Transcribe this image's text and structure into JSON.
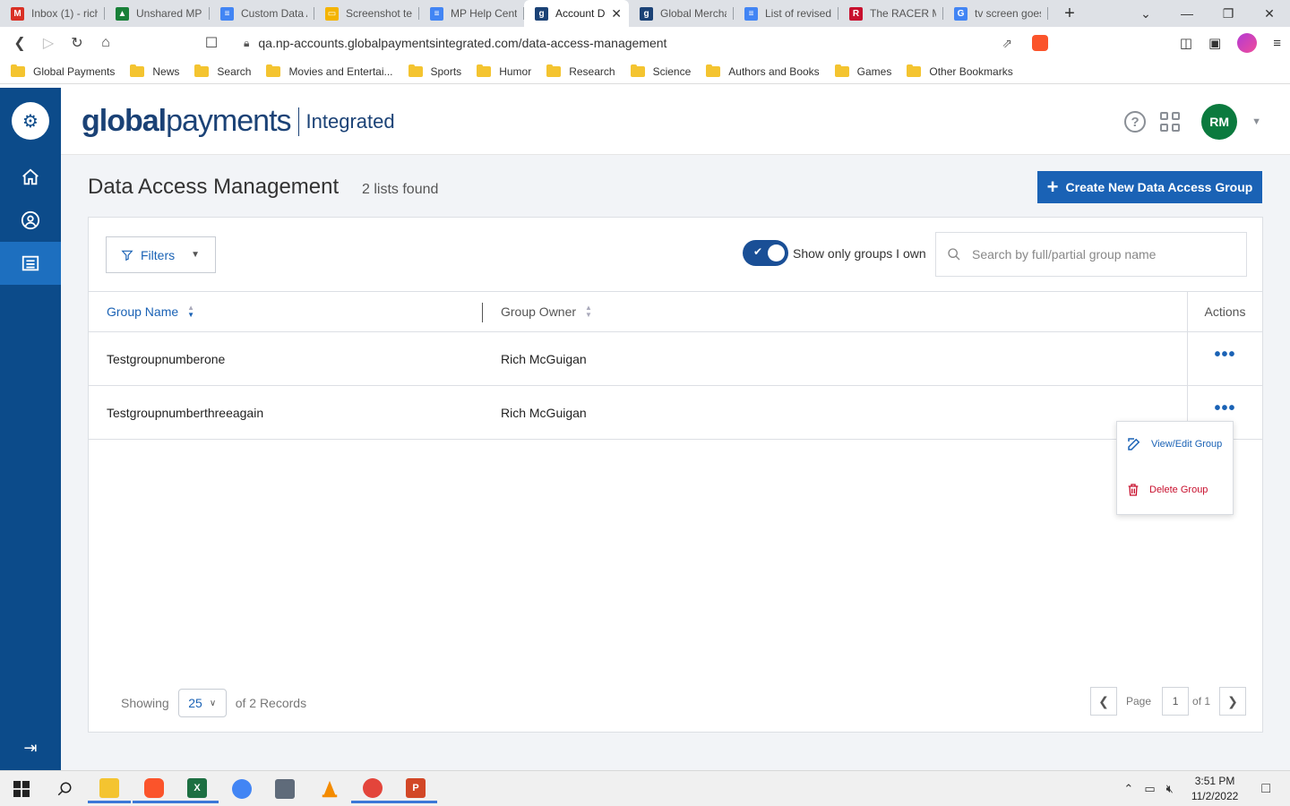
{
  "browser": {
    "tabs": [
      {
        "label": "Inbox (1) - rich",
        "icon": "gmail-icon",
        "color": "#d93025",
        "glyph": "M"
      },
      {
        "label": "Unshared MP H",
        "icon": "drive-icon",
        "color": "#188038",
        "glyph": "▲"
      },
      {
        "label": "Custom Data A",
        "icon": "docs-icon",
        "color": "#4285f4",
        "glyph": "≡"
      },
      {
        "label": "Screenshot tem",
        "icon": "slides-icon",
        "color": "#f4b400",
        "glyph": "▭"
      },
      {
        "label": "MP Help Cente",
        "icon": "docs-icon",
        "color": "#4285f4",
        "glyph": "≡"
      },
      {
        "label": "Account D",
        "icon": "globalpayments-icon",
        "color": "#1b4276",
        "glyph": "g",
        "active": true
      },
      {
        "label": "Global Mercha",
        "icon": "globalpayments-icon",
        "color": "#1b4276",
        "glyph": "g"
      },
      {
        "label": "List of revised",
        "icon": "docs-icon",
        "color": "#4285f4",
        "glyph": "≡"
      },
      {
        "label": "The RACER Ma",
        "icon": "racer-icon",
        "color": "#c8102e",
        "glyph": "R"
      },
      {
        "label": "tv screen goes",
        "icon": "google-icon",
        "color": "#4285f4",
        "glyph": "G"
      }
    ],
    "url": "qa.np-accounts.globalpaymentsintegrated.com/data-access-management",
    "bookmarks": [
      "Global Payments",
      "News",
      "Search",
      "Movies and Entertai...",
      "Sports",
      "Humor",
      "Research",
      "Science",
      "Authors and Books",
      "Games",
      "Other Bookmarks"
    ]
  },
  "header": {
    "brand_main": "payments",
    "brand_bold": "global",
    "brand_sub": "Integrated",
    "avatar_initials": "RM"
  },
  "page": {
    "title": "Data Access Management",
    "count_text": "2 lists found",
    "create_button": "Create New Data Access Group",
    "filters_label": "Filters",
    "toggle_label": "Show only groups I own",
    "toggle_on": true,
    "search_placeholder": "Search by full/partial group name",
    "search_value": ""
  },
  "table": {
    "columns": {
      "name": "Group Name",
      "owner": "Group Owner",
      "actions": "Actions"
    },
    "rows": [
      {
        "name": "Testgroupnumberone",
        "owner": "Rich McGuigan"
      },
      {
        "name": "Testgroupnumberthreeagain",
        "owner": "Rich McGuigan"
      }
    ],
    "menu": {
      "edit": "View/Edit Group",
      "delete": "Delete Group"
    }
  },
  "pagination": {
    "showing_label": "Showing",
    "page_size": "25",
    "records_label": "of 2 Records",
    "page_label": "Page",
    "current_page": "1",
    "of_pages": "of 1"
  },
  "taskbar": {
    "time": "3:51 PM",
    "date": "11/2/2022"
  },
  "colors": {
    "sidebar": "#0c4b8a",
    "accent": "#1a62b5",
    "avatar": "#0b7a3e",
    "danger": "#c8102e"
  }
}
